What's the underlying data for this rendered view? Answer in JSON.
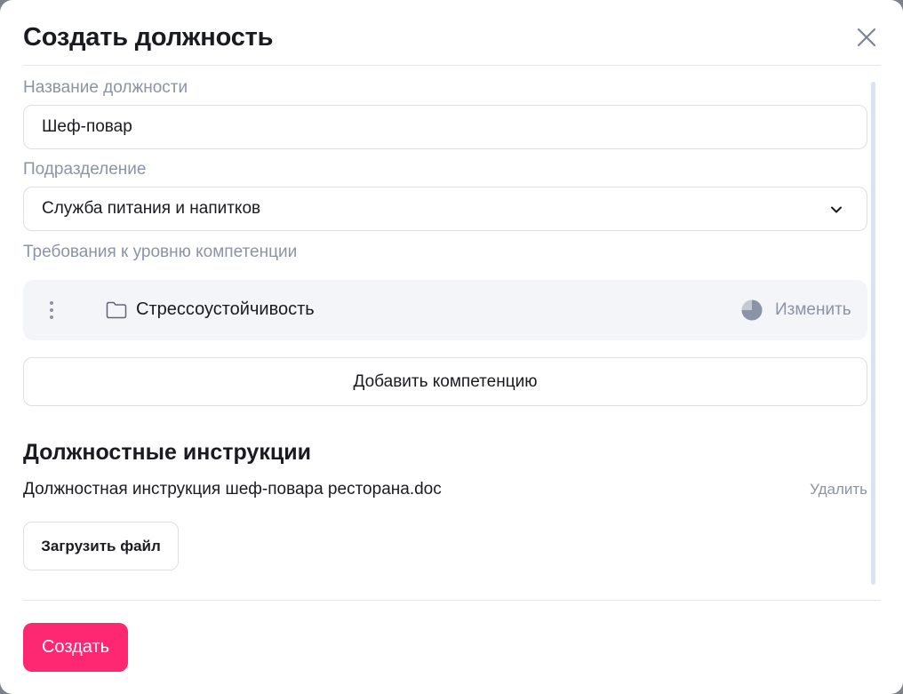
{
  "dialog": {
    "title": "Создать должность",
    "close_icon": "close-icon"
  },
  "form": {
    "position_name": {
      "label": "Название должности",
      "value": "Шеф-повар"
    },
    "department": {
      "label": "Подразделение",
      "selected": "Служба питания и напитков",
      "icon": "chevron-down-icon"
    },
    "competencies": {
      "label": "Требования к уровню компетенции",
      "items": [
        {
          "name": "Стрессоустойчивость",
          "icon": "folder-icon",
          "level_icon": "pie-chart-icon",
          "level_fraction": 0.75,
          "edit_label": "Изменить"
        }
      ],
      "add_label": "Добавить компетенцию"
    }
  },
  "instructions": {
    "title": "Должностные инструкции",
    "files": [
      {
        "name": "Должностная инструкция шеф-повара ресторана.doc",
        "delete_label": "Удалить"
      }
    ],
    "upload_label": "Загрузить файл"
  },
  "footer": {
    "create_label": "Создать"
  },
  "colors": {
    "accent": "#fe2772",
    "muted_text": "#8b93a7",
    "card_bg": "#f4f5f9",
    "border": "#dcdfe5"
  }
}
